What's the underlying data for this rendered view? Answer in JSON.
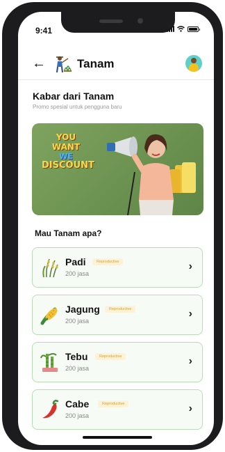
{
  "status": {
    "time": "9:41"
  },
  "header": {
    "title": "Tanam",
    "back_icon": "arrow-left-icon",
    "logo": "farmer-logo-icon",
    "avatar": "user-avatar"
  },
  "news": {
    "title": "Kabar dari Tanam",
    "subtitle": "Promo spesial untuk pengguna baru"
  },
  "banner": {
    "line1": "YOU WANT",
    "line2": "WE",
    "line3": "DISCOUNT"
  },
  "plants": {
    "title": "Mau Tanam apa?",
    "items": [
      {
        "name": "Padi",
        "badge": "Reproductive",
        "count": "200 jasa",
        "icon": "rice-icon"
      },
      {
        "name": "Jagung",
        "badge": "Reproductive",
        "count": "200 jasa",
        "icon": "corn-icon"
      },
      {
        "name": "Tebu",
        "badge": "Reproductive",
        "count": "200 jasa",
        "icon": "sugarcane-icon"
      },
      {
        "name": "Cabe",
        "badge": "Reproductive",
        "count": "200 jasa",
        "icon": "chili-icon"
      }
    ]
  },
  "colors": {
    "card_border": "#b9dcb6",
    "badge_text": "#d2a33d",
    "badge_bg": "#fdf2d6",
    "banner_bg": "#7fa35f"
  }
}
